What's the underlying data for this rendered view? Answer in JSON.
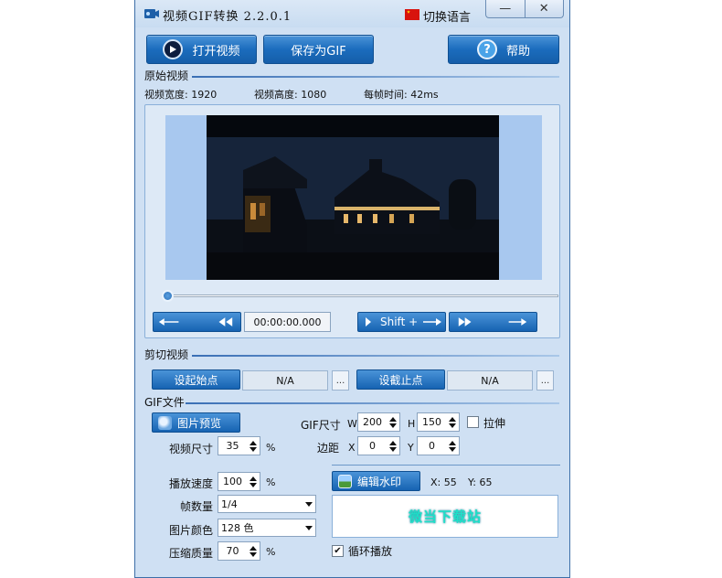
{
  "window": {
    "title": "视频GIF转换 2.2.0.1",
    "lang_label": "切换语言",
    "minimize_label": "—",
    "close_label": "✕"
  },
  "toolbar": {
    "open_label": "打开视频",
    "save_label": "保存为GIF",
    "help_label": "帮助"
  },
  "source": {
    "section_label": "原始视频",
    "width_text": "视频宽度: 1920",
    "height_text": "视频高度: 1080",
    "frame_time_text": "每帧时间: 42ms"
  },
  "playback": {
    "time": "00:00:00.000",
    "shift_label": "Shift +",
    "position_fraction": 0.0
  },
  "cut": {
    "section_label": "剪切视频",
    "start_label": "设起始点",
    "start_value": "N/A",
    "end_label": "设截止点",
    "end_value": "N/A",
    "dots": "..."
  },
  "gif": {
    "section_label": "GIF文件",
    "preview_label": "图片预览",
    "size_label": "GIF尺寸",
    "w_label": "W",
    "w_value": "200",
    "h_label": "H",
    "h_value": "150",
    "stretch_label": "拉伸",
    "video_size_label": "视频尺寸",
    "video_size_value": "35",
    "percent": "%",
    "margin_label": "边距",
    "x_label": "X",
    "x_value": "0",
    "y_label": "Y",
    "y_value": "0",
    "speed_label": "播放速度",
    "speed_value": "100",
    "frames_label": "帧数量",
    "frames_value": "1/4",
    "colors_label": "图片颜色",
    "colors_value": "128 色",
    "quality_label": "压缩质量",
    "quality_value": "70",
    "watermark_label": "编辑水印",
    "wm_x": "X: 55",
    "wm_y": "Y: 65",
    "watermark_text": "微当下载站",
    "loop_label": "循环播放"
  },
  "colors": {
    "accent": "#1b6cbd",
    "window_bg": "#cfe0f3",
    "watermark_text": "#1ee0c8"
  }
}
